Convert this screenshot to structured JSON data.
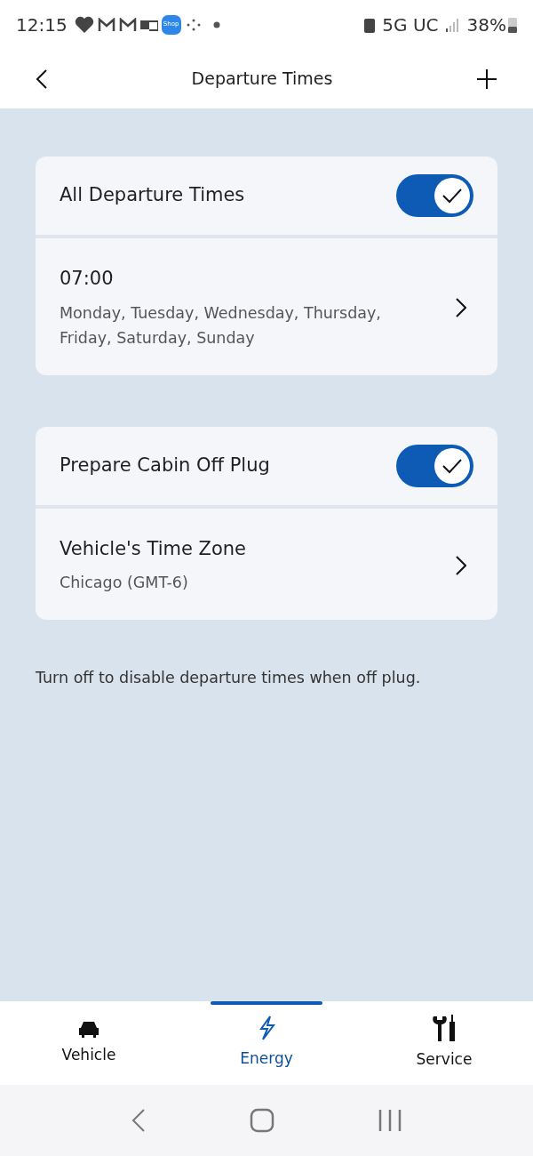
{
  "status_bar": {
    "time": "12:15",
    "shop_label": "Shop",
    "network": "5G UC",
    "battery": "38%"
  },
  "header": {
    "title": "Departure Times"
  },
  "sections": [
    {
      "toggle": {
        "label": "All Departure Times",
        "on": true
      },
      "row": {
        "title": "07:00",
        "subtitle": "Monday, Tuesday, Wednesday, Thursday, Friday, Saturday, Sunday"
      }
    },
    {
      "toggle": {
        "label": "Prepare Cabin Off Plug",
        "on": true
      },
      "row": {
        "title": "Vehicle's Time Zone",
        "subtitle": "Chicago (GMT-6)"
      }
    }
  ],
  "note": "Turn off to disable departure times when off plug.",
  "tabs": [
    {
      "label": "Vehicle",
      "kind": "car",
      "selected": false
    },
    {
      "label": "Energy",
      "kind": "bolt",
      "selected": true
    },
    {
      "label": "Service",
      "kind": "tools",
      "selected": false
    }
  ]
}
